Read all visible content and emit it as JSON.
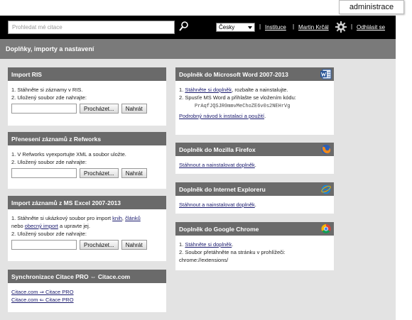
{
  "annotation": {
    "label": "administrace"
  },
  "header": {
    "search_placeholder": "Prohledat mé citace",
    "language": "Česky",
    "nav": [
      {
        "label": "Instituce"
      },
      {
        "label": "Martin Krčál"
      },
      {
        "label": "Odhlásit se"
      }
    ],
    "separator": "|"
  },
  "page": {
    "title": "Doplňky, importy a nastavení"
  },
  "left_panels": {
    "ris": {
      "title": "Import RIS",
      "step1": "1. Stáhněte si záznamy v RIS.",
      "step2": "2. Uložený soubor zde nahrajte:",
      "browse": "Procházet...",
      "upload": "Nahrát"
    },
    "refworks": {
      "title": "Přenesení záznamů z Refworks",
      "step1": "1. V Refworks vyexportujte XML a soubor uložte.",
      "step2": "2. Uložený soubor zde nahrajte:",
      "browse": "Procházet...",
      "upload": "Nahrát"
    },
    "excel": {
      "title": "Import záznamů z MS Excel 2007-2013",
      "step1_a": "1. Stáhněte si ukázkový soubor pro import ",
      "link_knih": "knih",
      "comma": ", ",
      "link_clanku": "článků",
      "step1_b": "nebo ",
      "link_obecny": "obecný import",
      "step1_c": " a upravte jej.",
      "step2": "2. Uložený soubor zde nahrajte:",
      "browse": "Procházet...",
      "upload": "Nahrát"
    },
    "sync": {
      "title": "Synchronizace Citace PRO ⇔ Citace.com",
      "link1": "Citace.com ⇒ Citace PRO",
      "link2": "Citace.com ⇐ Citace PRO"
    }
  },
  "right_panels": {
    "word": {
      "title": "Doplněk do Microsoft Word 2007-2013",
      "step1_link": "Stáhněte si doplněk",
      "step1_rest": ", rozbalte a nainstalujte.",
      "step1_num": "1. ",
      "step2": "2. Spusťe MS Word a přihlašte se vložením kódu:",
      "code": "PrAqfJQSJR0mmvMeChoZE6v0s2NEHrVg",
      "guide_link": "Podrobný návod k instalaci a použití",
      "guide_end": "."
    },
    "firefox": {
      "title": "Doplněk do Mozilla Firefox",
      "link": "Stáhnout a nainstalovat doplněk",
      "end": "."
    },
    "ie": {
      "title": "Doplněk do Internet Exploreru",
      "link": "Stáhnout a nainstalovat doplněk",
      "end": "."
    },
    "chrome": {
      "title": "Doplněk do Google Chrome",
      "step1_num": "1. ",
      "step1_link": "Stáhněte si doplněk",
      "step1_end": ".",
      "step2": "2. Soubor přetáhněte na stránku v prohlížeči:",
      "step3": "chrome://extensions/"
    }
  },
  "icons": {
    "search": "search-icon",
    "gear": "gear-icon",
    "word": "ms-word-icon",
    "firefox": "firefox-icon",
    "ie": "internet-explorer-icon",
    "chrome": "chrome-icon"
  },
  "colors": {
    "topbar": "#000000",
    "subbar": "#7a7a7a",
    "panel_header": "#6a6a6a",
    "content_bg": "#e3e3e3",
    "callout_accent": "#d40000"
  }
}
